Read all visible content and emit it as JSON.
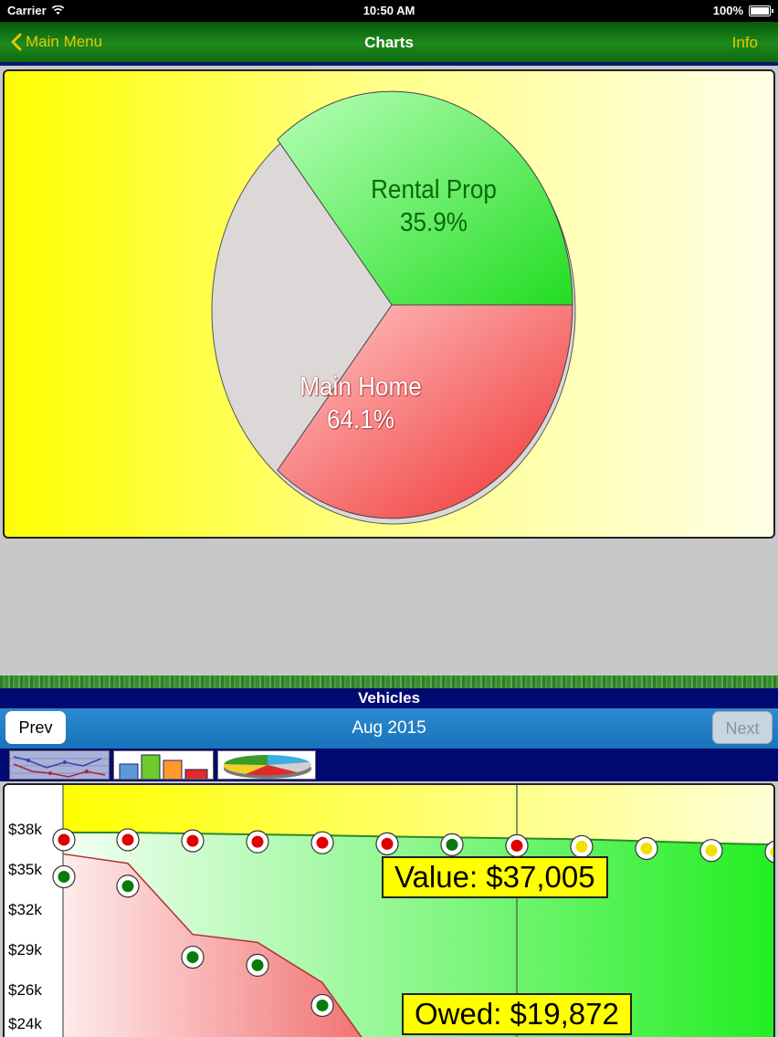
{
  "status_bar": {
    "carrier": "Carrier",
    "time": "10:50 AM",
    "battery": "100%"
  },
  "nav": {
    "back_label": "Main Menu",
    "title": "Charts",
    "info_label": "Info"
  },
  "pie": {
    "slices": [
      {
        "label": "Rental Prop",
        "percent_label": "35.9%",
        "value": 35.9,
        "color": "#33d633"
      },
      {
        "label": "Main Home",
        "percent_label": "64.1%",
        "value": 64.1,
        "color": "#f24040"
      }
    ]
  },
  "section": {
    "title": "Vehicles"
  },
  "period": {
    "prev_label": "Prev",
    "current": "Aug 2015",
    "next_label": "Next"
  },
  "chart_tabs": [
    {
      "name": "line-chart-tab-icon"
    },
    {
      "name": "bar-chart-tab-icon"
    },
    {
      "name": "pie-chart-tab-icon"
    }
  ],
  "chart_data": {
    "type": "line",
    "y_tick_labels": [
      "$38k",
      "$35k",
      "$32k",
      "$29k",
      "$26k",
      "$24k"
    ],
    "y_tick_values": [
      38000,
      35000,
      32000,
      29000,
      26000,
      23500
    ],
    "ylim": [
      23000,
      38600
    ],
    "series": [
      {
        "values": [
          37800,
          37800,
          37720,
          37650,
          37580,
          37500,
          37430,
          37360,
          37290,
          37150,
          37000,
          36900
        ],
        "marker_colors": [
          "red",
          "red",
          "red",
          "red",
          "red",
          "red",
          "green",
          "red",
          "yellow",
          "yellow",
          "yellow",
          "yellow"
        ],
        "color": "#2a8a2a"
      },
      {
        "values": [
          36200,
          35500,
          30200,
          29600,
          26600,
          19872
        ],
        "marker_colors": [
          "green",
          "green",
          "green",
          "green",
          "green",
          "none"
        ],
        "color": "#b03030"
      }
    ],
    "highlight_index": 7,
    "callouts": {
      "value_label": "Value: $37,005",
      "owed_label": "Owed: $19,872"
    }
  }
}
